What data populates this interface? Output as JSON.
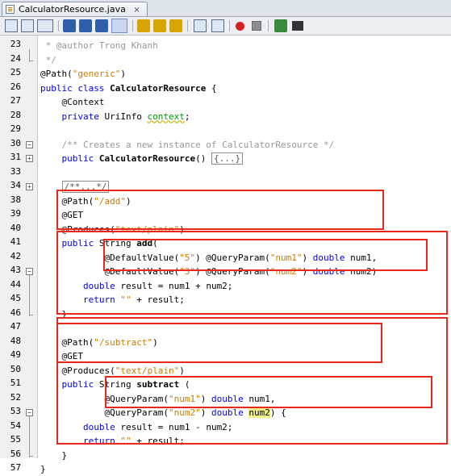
{
  "tab": {
    "title": "CalculatorResource.java",
    "close": "×"
  },
  "toolbar": {
    "icons": [
      "source-icon",
      "history-icon",
      "back-icon",
      "forward-icon",
      "find-icon",
      "find-prev-icon",
      "find-next-icon",
      "toggle-highlight-icon",
      "prev-bookmark-icon",
      "next-bookmark-icon",
      "toggle-bookmark-icon",
      "shift-left-icon",
      "shift-right-icon",
      "record-macro-icon",
      "stop-macro-icon",
      "comment-icon",
      "uncomment-icon"
    ]
  },
  "lines": [
    {
      "n": "23",
      "html": "<span class=\"cm\"> * @author Trong Khanh</span>"
    },
    {
      "n": "24",
      "html": "<span class=\"cm\"> */</span>"
    },
    {
      "n": "25",
      "html": "@Path(<span class=\"str\">\"generic\"</span>)"
    },
    {
      "n": "26",
      "html": "<span class=\"kw\">public class</span> <span class=\"b\">CalculatorResource</span> {"
    },
    {
      "n": "27",
      "html": "    @Context"
    },
    {
      "n": "28",
      "html": "    <span class=\"kw\">private</span> UriInfo <span class=\"fld\">context</span>;"
    },
    {
      "n": "29",
      "html": ""
    },
    {
      "n": "30",
      "html": "    <span class=\"cm\">/** Creates a new instance of CalculatorResource */</span>"
    },
    {
      "n": "31",
      "html": "    <span class=\"kw\">public</span> <span class=\"b\">CalculatorResource</span>() <span class=\"collapsed\">{...}</span>"
    },
    {
      "n": "33",
      "html": ""
    },
    {
      "n": "34",
      "html": "    <span class=\"collapsed cm\">/**...*/</span>"
    },
    {
      "n": "38",
      "html": "    @Path(<span class=\"str\">\"/add\"</span>)"
    },
    {
      "n": "39",
      "html": "    @GET"
    },
    {
      "n": "40",
      "html": "    @Produces(<span class=\"str\">\"text/plain\"</span>)"
    },
    {
      "n": "41",
      "html": "    <span class=\"kw\">public</span> String <span class=\"b\">add</span>("
    },
    {
      "n": "42",
      "html": "            @DefaultValue(<span class=\"str\">\"5\"</span>) @QueryParam(<span class=\"str\">\"num1\"</span>) <span class=\"kw\">double</span> num1,"
    },
    {
      "n": "43",
      "html": "            @DefaultValue(<span class=\"str\">\"3\"</span>) @QueryParam(<span class=\"str\">\"num2\"</span>) <span class=\"kw\">double</span> num2)"
    },
    {
      "n": "44",
      "html": "        <span class=\"kw\">double</span> result = num1 + num2;"
    },
    {
      "n": "45",
      "html": "        <span class=\"kw\">return</span> <span class=\"str\">\"\"</span> + result;"
    },
    {
      "n": "46",
      "html": "    }"
    },
    {
      "n": "47",
      "html": ""
    },
    {
      "n": "48",
      "html": "    @Path(<span class=\"str\">\"/subtract\"</span>)"
    },
    {
      "n": "49",
      "html": "    @GET"
    },
    {
      "n": "50",
      "html": "    @Produces(<span class=\"str\">\"text/plain\"</span>)"
    },
    {
      "n": "51",
      "html": "    <span class=\"kw\">public</span> String <span class=\"b\">subtract</span> ("
    },
    {
      "n": "52",
      "html": "            @QueryParam(<span class=\"str\">\"num1\"</span>) <span class=\"kw\">double</span> num1,"
    },
    {
      "n": "53",
      "html": "            @QueryParam(<span class=\"str\">\"num2\"</span>) <span class=\"kw\">double</span> <span class=\"hl\">num2</span>) {"
    },
    {
      "n": "54",
      "html": "        <span class=\"kw\">double</span> result = num1 - num2;"
    },
    {
      "n": "55",
      "html": "        <span class=\"kw\">return</span> <span class=\"str\">\"\"</span> + result;"
    },
    {
      "n": "56",
      "html": "    }"
    },
    {
      "n": "57",
      "html": "}"
    }
  ]
}
